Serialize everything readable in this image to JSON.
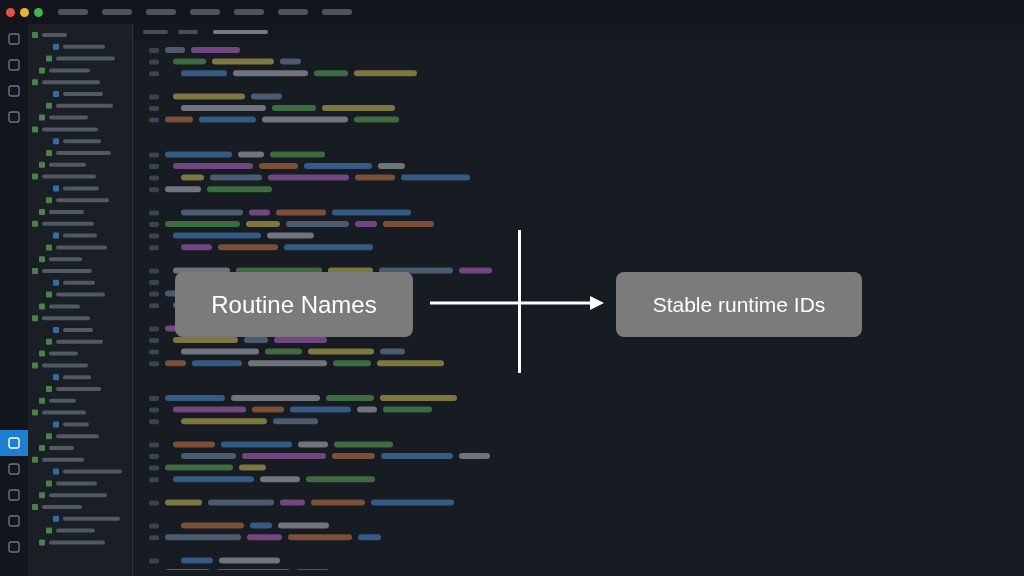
{
  "activity_bar": {
    "items": [
      {
        "selected": false
      },
      {
        "selected": false
      },
      {
        "selected": false
      },
      {
        "selected": false
      },
      {
        "selected": true
      },
      {
        "selected": false
      },
      {
        "selected": false
      },
      {
        "selected": false
      },
      {
        "selected": false
      }
    ]
  },
  "overlay": {
    "source_label": "Routine Names",
    "target_label": "Stable runtime IDs"
  }
}
